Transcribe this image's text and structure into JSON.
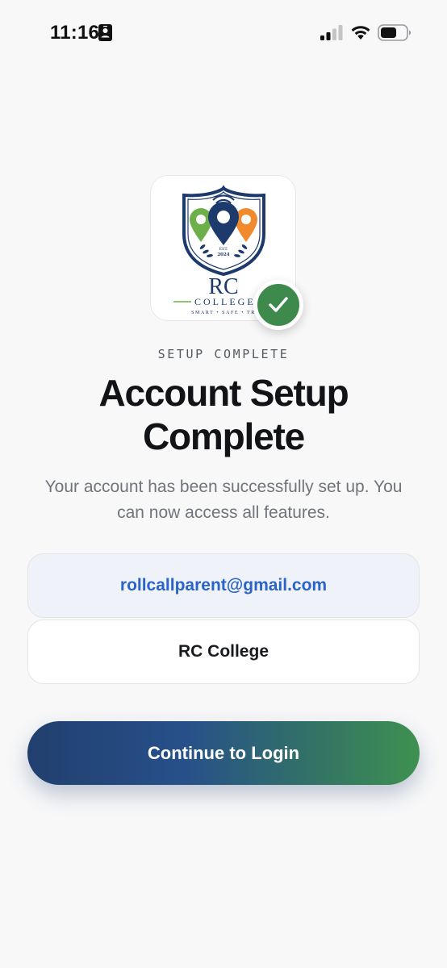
{
  "status_bar": {
    "time": "11:16",
    "icons": [
      "id-card-icon",
      "signal-icon",
      "wifi-icon",
      "battery-icon"
    ]
  },
  "logo": {
    "name": "RC",
    "wordmark": "COLLEGE",
    "tagline": "SMART • SAFE • TR",
    "est_label": "EST.",
    "est_year": "2024",
    "badge_icon": "check-icon",
    "colors": {
      "navy": "#1c3a6b",
      "green": "#6db04a",
      "orange": "#f08a2c",
      "badge": "#3e8a4d"
    }
  },
  "main": {
    "eyebrow": "SETUP COMPLETE",
    "title_line1": "Account Setup",
    "title_line2": "Complete",
    "subtitle_line1": "Your account has been successfully set up. You",
    "subtitle_line2": "can now access all features."
  },
  "fields": {
    "email": "rollcallparent@gmail.com",
    "college": "RC College"
  },
  "actions": {
    "continue_label": "Continue to Login"
  },
  "colors": {
    "background": "#f8f8f9",
    "email_text": "#2a64c8",
    "button_gradient_start": "#213f6e",
    "button_gradient_end": "#3e9150"
  }
}
